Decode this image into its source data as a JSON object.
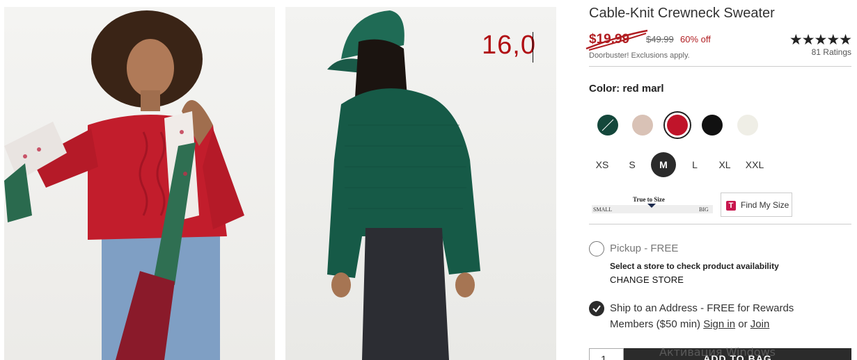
{
  "product": {
    "title": "Cable-Knit Crewneck Sweater",
    "sale_price": "$19.99",
    "original_price": "$49.99",
    "discount": "60% off",
    "promo_note": "Doorbuster! Exclusions apply.",
    "stars": "★★★★★",
    "ratings": "81 Ratings"
  },
  "overlay": {
    "text": "16,0"
  },
  "color": {
    "label": "Color:",
    "selected": "red marl",
    "swatches": [
      {
        "name": "green",
        "hex": "#14473b"
      },
      {
        "name": "oatmeal",
        "hex": "#d9c2b6"
      },
      {
        "name": "red marl",
        "hex": "#c0142a"
      },
      {
        "name": "black",
        "hex": "#111111"
      },
      {
        "name": "ivory",
        "hex": "#efeee6"
      }
    ]
  },
  "sizes": {
    "options": [
      "XS",
      "S",
      "M",
      "L",
      "XL",
      "XXL"
    ],
    "selected": "M"
  },
  "fit": {
    "title": "True to Size",
    "small": "SMALL",
    "big": "BIG",
    "find_my_size": "Find My Size",
    "logo_letter": "T"
  },
  "fulfillment": {
    "pickup": "Pickup - FREE",
    "store_message": "Select a store to check product availability",
    "change_store": "CHANGE STORE",
    "ship_line1": "Ship to an Address - FREE for Rewards",
    "ship_members": "Members ($50 min)",
    "sign_in": "Sign in",
    "or": "or",
    "join": "Join"
  },
  "cart": {
    "quantity": "1",
    "button_label": "ADD TO BAG"
  },
  "system": {
    "watermark": "Активация Windows"
  },
  "colors": {
    "sale_red": "#b11e22",
    "dark": "#2b2b2b"
  }
}
